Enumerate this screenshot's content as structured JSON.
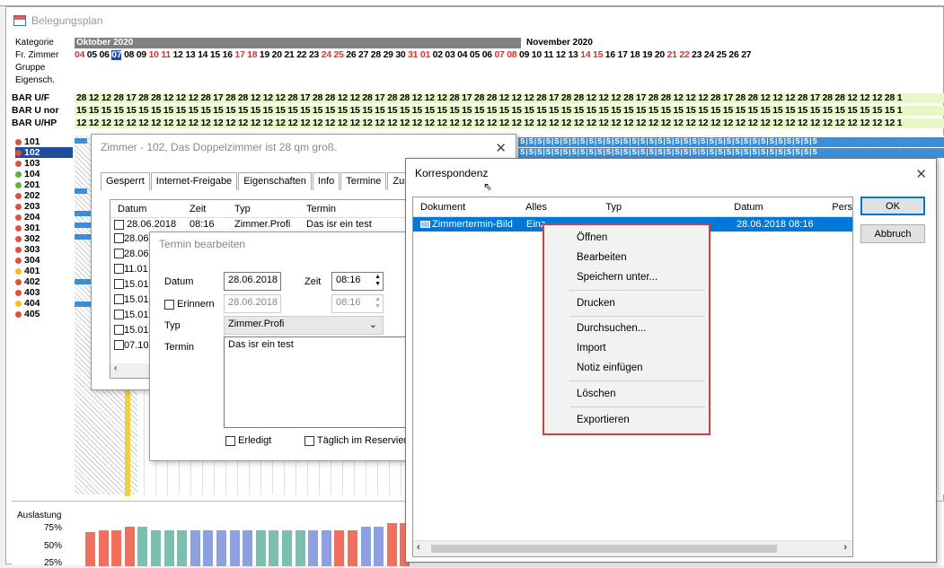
{
  "window": {
    "title": "Belegungsplan"
  },
  "labels": {
    "kategorie": "Kategorie",
    "frzimmer": "Fr. Zimmer",
    "gruppe": "Gruppe",
    "eigensch": "Eigensch."
  },
  "months": {
    "oct": "Oktober 2020",
    "nov": "November 2020"
  },
  "dates": [
    {
      "d": "04",
      "w": 1
    },
    {
      "d": "05",
      "w": 0
    },
    {
      "d": "06",
      "w": 0
    },
    {
      "d": "07",
      "w": 0,
      "sel": 1
    },
    {
      "d": "08",
      "w": 0
    },
    {
      "d": "09",
      "w": 0
    },
    {
      "d": "10",
      "w": 1
    },
    {
      "d": "11",
      "w": 1
    },
    {
      "d": "12",
      "w": 0
    },
    {
      "d": "13",
      "w": 0
    },
    {
      "d": "14",
      "w": 0
    },
    {
      "d": "15",
      "w": 0
    },
    {
      "d": "16",
      "w": 0
    },
    {
      "d": "17",
      "w": 1
    },
    {
      "d": "18",
      "w": 1
    },
    {
      "d": "19",
      "w": 0
    },
    {
      "d": "20",
      "w": 0
    },
    {
      "d": "21",
      "w": 0
    },
    {
      "d": "22",
      "w": 0
    },
    {
      "d": "23",
      "w": 0
    },
    {
      "d": "24",
      "w": 1
    },
    {
      "d": "25",
      "w": 1
    },
    {
      "d": "26",
      "w": 0
    },
    {
      "d": "27",
      "w": 0
    },
    {
      "d": "28",
      "w": 0
    },
    {
      "d": "29",
      "w": 0
    },
    {
      "d": "30",
      "w": 0
    },
    {
      "d": "31",
      "w": 1
    },
    {
      "d": "01",
      "w": 1
    },
    {
      "d": "02",
      "w": 0
    },
    {
      "d": "03",
      "w": 0
    },
    {
      "d": "04",
      "w": 0
    },
    {
      "d": "05",
      "w": 0
    },
    {
      "d": "06",
      "w": 0
    },
    {
      "d": "07",
      "w": 1
    },
    {
      "d": "08",
      "w": 1
    },
    {
      "d": "09",
      "w": 0
    },
    {
      "d": "10",
      "w": 0
    },
    {
      "d": "11",
      "w": 0
    },
    {
      "d": "12",
      "w": 0
    },
    {
      "d": "13",
      "w": 0
    },
    {
      "d": "14",
      "w": 1
    },
    {
      "d": "15",
      "w": 1
    },
    {
      "d": "16",
      "w": 0
    },
    {
      "d": "17",
      "w": 0
    },
    {
      "d": "18",
      "w": 0
    },
    {
      "d": "19",
      "w": 0
    },
    {
      "d": "20",
      "w": 0
    },
    {
      "d": "21",
      "w": 1
    },
    {
      "d": "22",
      "w": 1
    },
    {
      "d": "23",
      "w": 0
    },
    {
      "d": "24",
      "w": 0
    },
    {
      "d": "25",
      "w": 0
    },
    {
      "d": "26",
      "w": 0
    },
    {
      "d": "27",
      "w": 0
    }
  ],
  "bar_rows": [
    {
      "label": "BAR Ü/F",
      "values": "28 12 12 28 17 28 28 12 12 12 28 17 28 28 12 12 12 28 17 28 28 12 12 28 17 28 28 12 12 12 28 17 28 28 12 12 12 28 17 28 28 12 12 12 28 17 28 28 12 12 12 28 17 28 28 12 12 12 28 17 28 28 12 12 12 28 1"
    },
    {
      "label": "BAR Ü nor",
      "values": "15 15 15 15 15 15 15 15 15 15 15 15 15 15 15 15 15 15 15 15 15 15 15 15 15 15 15 15 15 15 15 15 15 15 15 15 15 15 15 15 15 15 15 15 15 15 15 15 15 15 15 15 15 15 15 15 15 15 15 15 15 15 15 15 15 15 1"
    },
    {
      "label": "BAR Ü/HP",
      "values": "12 12 12 12 12 12 12 12 12 12 12 12 12 12 12 12 12 12 12 12 12 12 12 12 12 12 12 12 12 12 12 12 12 12 12 12 12 12 12 12 12 12 12 12 12 12 12 12 12 12 12 12 12 12 12 12 12 12 12 12 12 12 12 12 12 12 1"
    }
  ],
  "rooms": [
    {
      "n": "101",
      "c": "#e05040"
    },
    {
      "n": "102",
      "c": "#e05040",
      "sel": 1
    },
    {
      "n": "103",
      "c": "#e05040"
    },
    {
      "n": "104",
      "c": "#60b040"
    },
    {
      "n": "201",
      "c": "#60b040"
    },
    {
      "n": "202",
      "c": "#e05040"
    },
    {
      "n": "203",
      "c": "#e05040"
    },
    {
      "n": "204",
      "c": "#e05040"
    },
    {
      "n": "301",
      "c": "#e05040"
    },
    {
      "n": "302",
      "c": "#e05040"
    },
    {
      "n": "303",
      "c": "#e05040"
    },
    {
      "n": "304",
      "c": "#e05040"
    },
    {
      "n": "401",
      "c": "#f0c020"
    },
    {
      "n": "402",
      "c": "#e05040"
    },
    {
      "n": "403",
      "c": "#e05040"
    },
    {
      "n": "404",
      "c": "#f0c020"
    },
    {
      "n": "405",
      "c": "#e05040"
    }
  ],
  "occupancy": {
    "label": "Auslastung",
    "p75": "75%",
    "p50": "50%",
    "p25": "25%"
  },
  "zimmer_dialog": {
    "title": "Zimmer - 102, Das Doppelzimmer ist 28 qm groß.",
    "tabs": [
      "Gesperrt",
      "Internet-Freigabe",
      "Eigenschaften",
      "Info",
      "Termine",
      "Zus"
    ],
    "cols": [
      "Datum",
      "Zeit",
      "Typ",
      "Termin"
    ],
    "row0": {
      "datum": "28.06.2018",
      "zeit": "08:16",
      "typ": "Zimmer.Profi",
      "termin": "Das isr ein test"
    },
    "rows": [
      "28.06",
      "28.06",
      "11.01",
      "15.01",
      "15.01",
      "15.01",
      "15.01",
      "07.10"
    ]
  },
  "termin_dialog": {
    "title": "Termin bearbeiten",
    "datum_label": "Datum",
    "datum": "28.06.2018",
    "zeit_label": "Zeit",
    "zeit": "08:16",
    "erinnern_label": "Erinnern",
    "erinnern_datum": "28.06.2018",
    "erinnern_zeit": "08:16",
    "typ_label": "Typ",
    "typ": "Zimmer.Profi",
    "termin_label": "Termin",
    "termin": "Das isr ein test",
    "erledigt": "Erledigt",
    "taeglich": "Täglich im Reservier"
  },
  "korr_dialog": {
    "title": "Korrespondenz",
    "cols": [
      "Dokument",
      "Alles",
      "Typ",
      "Datum",
      "Pers"
    ],
    "row": {
      "dokument": "Zimmertermin-Bild",
      "alles": "Einz",
      "datum": "28.06.2018 08:16"
    },
    "ok": "OK",
    "cancel": "Abbruch"
  },
  "context_menu": [
    "Öffnen",
    "Bearbeiten",
    "Speichern unter...",
    "Drucken",
    "Durchsuchen...",
    "Import",
    "Notiz einfügen",
    "Löschen",
    "Exportieren"
  ],
  "colors": {
    "weekend": "#e03030",
    "selected_date_bg": "#1f4e9c",
    "price_bg": "#e8f6c8",
    "menu_border": "#d04040",
    "selection": "#0078d7"
  }
}
